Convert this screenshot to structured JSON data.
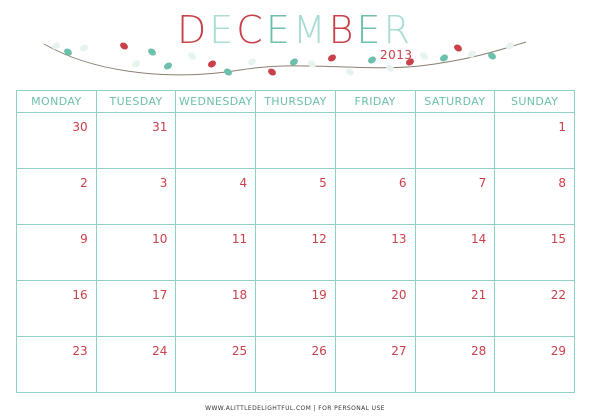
{
  "header": {
    "month_letters": [
      {
        "ch": "D",
        "color": "#c9404a"
      },
      {
        "ch": "E",
        "color": "#a8ddd3"
      },
      {
        "ch": "C",
        "color": "#c9404a"
      },
      {
        "ch": "E",
        "color": "#6cc0ad"
      },
      {
        "ch": "M",
        "color": "#a8ddd3"
      },
      {
        "ch": "B",
        "color": "#c9404a"
      },
      {
        "ch": "E",
        "color": "#6cc0ad"
      },
      {
        "ch": "R",
        "color": "#a8ddd3"
      }
    ],
    "year": "2013"
  },
  "calendar": {
    "weekdays": [
      "MONDAY",
      "TUESDAY",
      "WEDNESDAY",
      "THURSDAY",
      "FRIDAY",
      "SATURDAY",
      "SUNDAY"
    ],
    "weeks": [
      [
        "30",
        "31",
        "",
        "",
        "",
        "",
        "1"
      ],
      [
        "2",
        "3",
        "4",
        "5",
        "6",
        "7",
        "8"
      ],
      [
        "9",
        "10",
        "11",
        "12",
        "13",
        "14",
        "15"
      ],
      [
        "16",
        "17",
        "18",
        "19",
        "20",
        "21",
        "22"
      ],
      [
        "23",
        "24",
        "25",
        "26",
        "27",
        "28",
        "29"
      ]
    ]
  },
  "footer": {
    "text": "WWW.ALITTLEDELIGHTFUL.COM | FOR PERSONAL USE"
  },
  "colors": {
    "red": "#c9404a",
    "mint": "#6cc0ad",
    "pale_mint": "#a8ddd3",
    "grid": "#8fd1c4",
    "bulb_white": "#e8f3f0",
    "wire": "#8a8070"
  },
  "decor": {
    "icon": "christmas-lights-garland-icon"
  }
}
